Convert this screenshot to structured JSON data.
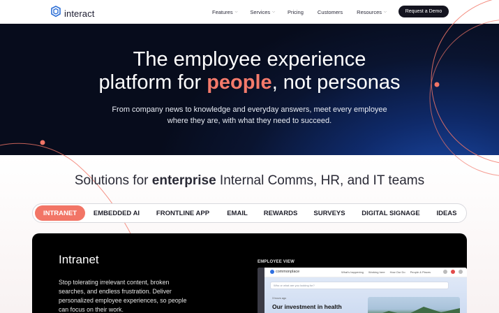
{
  "nav": {
    "brand": "interact",
    "links": [
      {
        "label": "Features",
        "caret": true
      },
      {
        "label": "Services",
        "caret": true
      },
      {
        "label": "Pricing",
        "caret": false
      },
      {
        "label": "Customers",
        "caret": false
      },
      {
        "label": "Resources",
        "caret": true
      }
    ],
    "cta": "Request a Demo"
  },
  "hero": {
    "title_line1": "The employee experience",
    "title_line2_pre": "platform for ",
    "title_line2_accent": "people",
    "title_line2_post": ", not personas",
    "subtitle_line1": "From company news to knowledge and everyday answers, meet every employee",
    "subtitle_line2": "where they are, with what they need to succeed."
  },
  "solutions": {
    "title_pre": "Solutions for ",
    "title_bold": "enterprise",
    "title_post": " Internal Comms, HR, and IT teams",
    "tabs": [
      "INTRANET",
      "EMBEDDED AI",
      "FRONTLINE APP",
      "EMAIL",
      "REWARDS",
      "SURVEYS",
      "DIGITAL SIGNAGE",
      "IDEAS"
    ],
    "active_tab": "INTRANET"
  },
  "card": {
    "title": "Intranet",
    "body": "Stop tolerating irrelevant content, broken searches, and endless frustration. Deliver personalized employee experiences, so people can focus on their work.",
    "view_label": "EMPLOYEE VIEW",
    "mock": {
      "brand": "commonplace",
      "menu": [
        "What's happening",
        "Working here",
        "How Our Do",
        "People & Places"
      ],
      "search_placeholder": "Who or what are you looking for?",
      "meta": "3 hours ago",
      "headline": "Our investment in health"
    }
  },
  "colors": {
    "accent": "#f27566",
    "hero_dark": "#070c1c",
    "hero_blue": "#1b4aa8",
    "button_dark": "#14141f"
  }
}
